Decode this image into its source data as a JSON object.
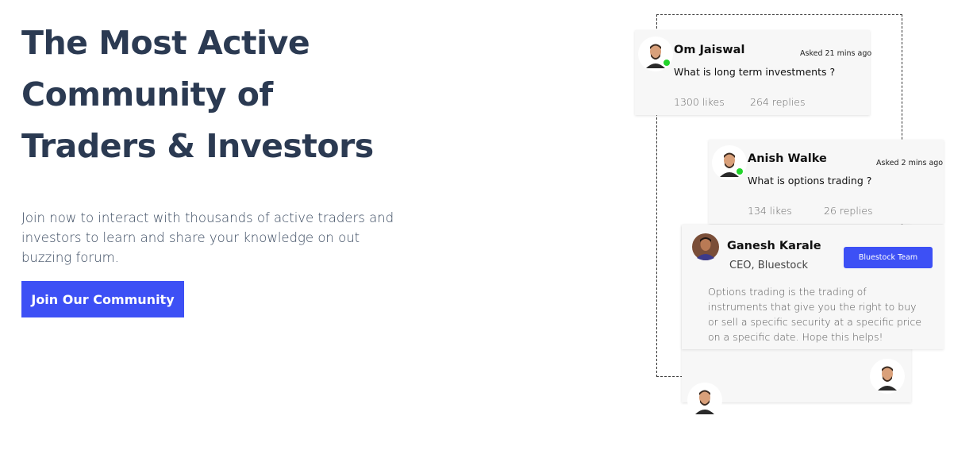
{
  "hero": {
    "title_lines": [
      "The Most Active",
      "Community of",
      "Traders & Investors"
    ],
    "description": "Join now to interact with thousands of active traders and investors to learn and share your knowledge on out buzzing forum.",
    "cta_label": "Join Our Community"
  },
  "colors": {
    "primary": "#3d50f5",
    "heading": "#2b3a52",
    "online": "#22d42a"
  },
  "posts": [
    {
      "name": "Om Jaiswal",
      "asked": "Asked 21 mins ago",
      "question": "What is long term investments ?",
      "likes": "1300 likes",
      "replies": "264 replies"
    },
    {
      "name": "Anish Walke",
      "asked": "Asked 2 mins ago",
      "question": "What is options trading ?",
      "likes": "134 likes",
      "replies": "26 replies"
    }
  ],
  "answer": {
    "name": "Ganesh Karale",
    "role": "CEO, Bluestock",
    "badge": "Bluestock Team",
    "text": "Options trading is the trading of instruments that give you the right to buy or sell a specific security at a specific price on a specific date. Hope this helps!"
  }
}
